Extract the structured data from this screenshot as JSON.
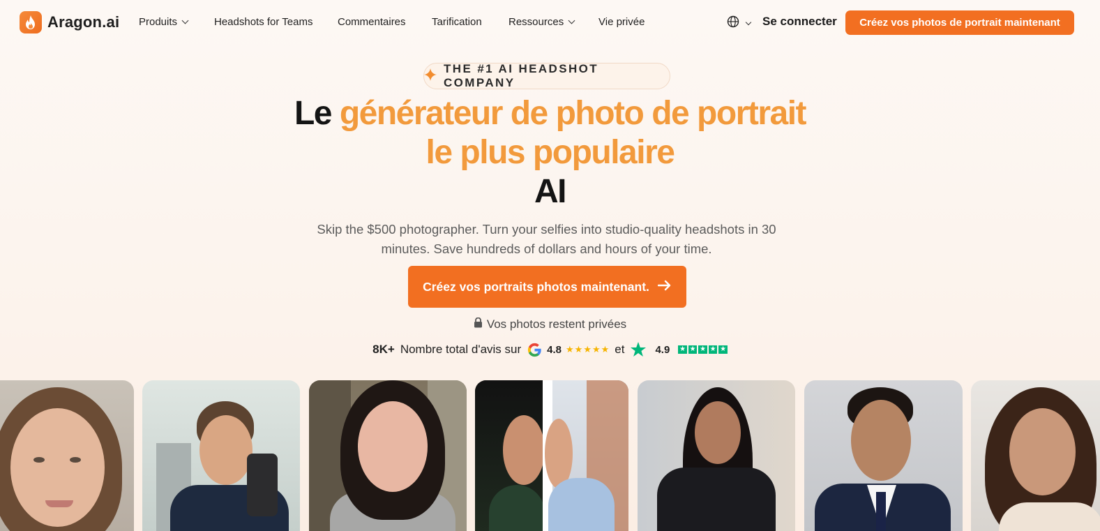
{
  "brand": {
    "name": "Aragon.ai"
  },
  "nav": {
    "items": [
      {
        "label": "Produits",
        "dropdown": true
      },
      {
        "label": "Headshots for Teams",
        "dropdown": false
      },
      {
        "label": "Commentaires",
        "dropdown": false
      },
      {
        "label": "Tarification",
        "dropdown": false
      },
      {
        "label": "Ressources",
        "dropdown": true
      },
      {
        "label": "Vie privée",
        "dropdown": false
      }
    ],
    "language_icon": "globe-icon",
    "signin_label": "Se connecter",
    "cta_label": "Créez vos photos de portrait maintenant"
  },
  "hero": {
    "badge": "THE #1 AI HEADSHOT COMPANY",
    "headline_part1": "Le ",
    "headline_highlight": "générateur de photo de portrait le plus populaire",
    "headline_part2": "AI",
    "subtitle": "Skip the $500 photographer. Turn your selfies into studio-quality headshots in 30 minutes. Save hundreds of dollars and hours of your time.",
    "cta_label": "Créez vos portraits photos maintenant.",
    "privacy_note": "Vos photos restent privées"
  },
  "reviews": {
    "count": "8K+",
    "label": "Nombre total d'avis sur",
    "google_rating": "4.8",
    "connector": "et",
    "trustpilot_rating": "4.9"
  },
  "colors": {
    "accent": "#f26f21",
    "highlight": "#f29a3c",
    "google_star": "#f6b400",
    "trustpilot": "#00b67a"
  },
  "photos": [
    {
      "name": "portrait-woman-selfie"
    },
    {
      "name": "portrait-man-mirror-selfie"
    },
    {
      "name": "portrait-woman-street"
    },
    {
      "name": "portrait-man-before-after"
    },
    {
      "name": "portrait-woman-office"
    },
    {
      "name": "portrait-man-suit"
    },
    {
      "name": "portrait-woman-light"
    }
  ]
}
